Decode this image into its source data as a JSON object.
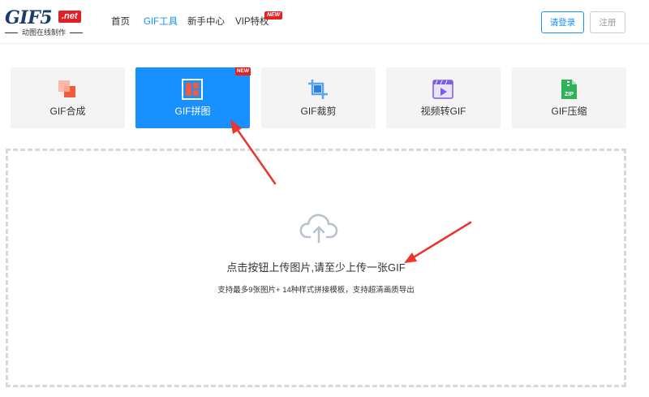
{
  "logo": {
    "brand": "GIF5",
    "domain": ".net",
    "tagline": "动图在线制作"
  },
  "nav": {
    "items": [
      {
        "label": "首页",
        "active": false
      },
      {
        "label": "GIF工具",
        "active": true
      },
      {
        "label": "新手中心",
        "active": false
      },
      {
        "label": "VIP特权",
        "active": false
      }
    ],
    "vip_badge": "NEW"
  },
  "auth": {
    "login_label": "请登录",
    "register_label": "注册"
  },
  "tools": [
    {
      "label": "GIF合成",
      "icon": "gif-compose-icon",
      "active": false
    },
    {
      "label": "GIF拼图",
      "icon": "gif-collage-icon",
      "active": true,
      "badge": "NEW"
    },
    {
      "label": "GIF裁剪",
      "icon": "crop-icon",
      "active": false
    },
    {
      "label": "视频转GIF",
      "icon": "video-to-gif-icon",
      "active": false
    },
    {
      "label": "GIF压缩",
      "icon": "zip-icon",
      "active": false
    }
  ],
  "upload": {
    "title": "点击按钮上传图片,请至少上传一张GIF",
    "subtitle": "支持最多9张图片+ 14种样式拼接模板，支持超清画质导出"
  },
  "colors": {
    "accent": "#1890ff",
    "badge": "#e62121",
    "arrow": "#e8372d",
    "card_bg": "#f4f4f4"
  }
}
